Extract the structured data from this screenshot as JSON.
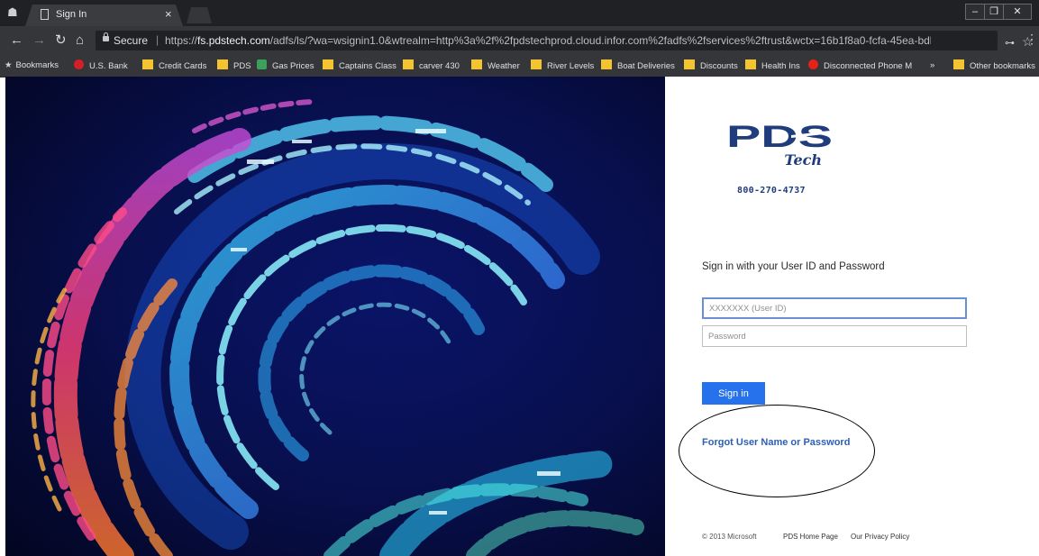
{
  "browser": {
    "tab_title": "Sign In",
    "secure_label": "Secure",
    "url_prefix": "https://",
    "url_host": "fs.pdstech.com",
    "url_rest": "/adfs/ls/?wa=wsignin1.0&wtrealm=http%3a%2f%2fpdstechprod.cloud.infor.com%2fadfs%2fservices%2ftrust&wctx=16b1f8a0-fcfa-45ea-bdb3-54e..."
  },
  "bookmarks": [
    {
      "label": "Bookmarks",
      "icon": "star-icon"
    },
    {
      "label": "U.S. Bank",
      "icon": "bank-favicon",
      "color": "#d22027"
    },
    {
      "label": "Credit Cards",
      "icon": "folder-icon"
    },
    {
      "label": "PDS",
      "icon": "folder-icon"
    },
    {
      "label": "Gas Prices",
      "icon": "gas-favicon",
      "color": "#3aa05a"
    },
    {
      "label": "Captains Class",
      "icon": "folder-icon"
    },
    {
      "label": "carver 430",
      "icon": "folder-icon"
    },
    {
      "label": "Weather",
      "icon": "folder-icon"
    },
    {
      "label": "River Levels",
      "icon": "folder-icon"
    },
    {
      "label": "Boat Deliveries",
      "icon": "folder-icon"
    },
    {
      "label": "Discounts",
      "icon": "folder-icon"
    },
    {
      "label": "Health Ins",
      "icon": "folder-icon"
    },
    {
      "label": "Disconnected Phone M",
      "icon": "youtube-favicon",
      "color": "#e62117"
    },
    {
      "label": "»",
      "icon": "overflow-chevron"
    },
    {
      "label": "Other bookmarks",
      "icon": "folder-icon"
    }
  ],
  "login": {
    "logo_text": "PDS",
    "logo_sub": "Tech",
    "phone": "800-270-4737",
    "heading": "Sign in with your User ID and Password",
    "userid_placeholder": "XXXXXXX (User ID)",
    "password_placeholder": "Password",
    "signin_label": "Sign in",
    "forgot_label": "Forgot User Name or Password",
    "footer_copyright": "© 2013 Microsoft",
    "footer_home": "PDS Home Page",
    "footer_privacy": "Our Privacy Policy"
  },
  "colors": {
    "accent": "#2672ec",
    "logo_blue": "#1f3c7d",
    "folder": "#f4c430"
  }
}
